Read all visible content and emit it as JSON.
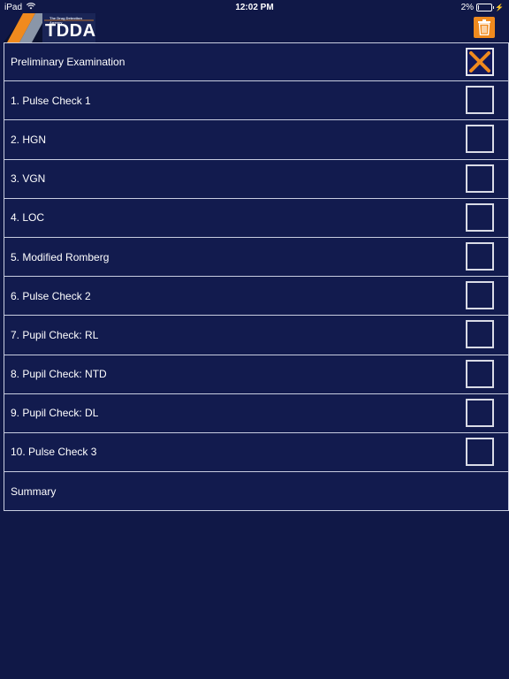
{
  "status_bar": {
    "carrier": "iPad",
    "time": "12:02 PM",
    "battery": "2%"
  },
  "header": {
    "logo_tagline": "The Drug Detection Agency",
    "logo_text": "TDDA",
    "trash_icon": "trash-icon"
  },
  "colors": {
    "background": "#101847",
    "accent": "#f08a1e",
    "border": "#c8cde0"
  },
  "rows": [
    {
      "label": "Preliminary Examination",
      "checkbox": true,
      "checked": true
    },
    {
      "label": "1. Pulse Check 1",
      "checkbox": true,
      "checked": false
    },
    {
      "label": "2. HGN",
      "checkbox": true,
      "checked": false
    },
    {
      "label": "3. VGN",
      "checkbox": true,
      "checked": false
    },
    {
      "label": "4. LOC",
      "checkbox": true,
      "checked": false
    },
    {
      "label": "5. Modified Romberg",
      "checkbox": true,
      "checked": false
    },
    {
      "label": "6. Pulse Check 2",
      "checkbox": true,
      "checked": false
    },
    {
      "label": "7. Pupil Check: RL",
      "checkbox": true,
      "checked": false
    },
    {
      "label": "8. Pupil Check: NTD",
      "checkbox": true,
      "checked": false
    },
    {
      "label": "9. Pupil Check: DL",
      "checkbox": true,
      "checked": false
    },
    {
      "label": "10. Pulse Check 3",
      "checkbox": true,
      "checked": false
    },
    {
      "label": "Summary",
      "checkbox": false,
      "checked": false
    }
  ]
}
